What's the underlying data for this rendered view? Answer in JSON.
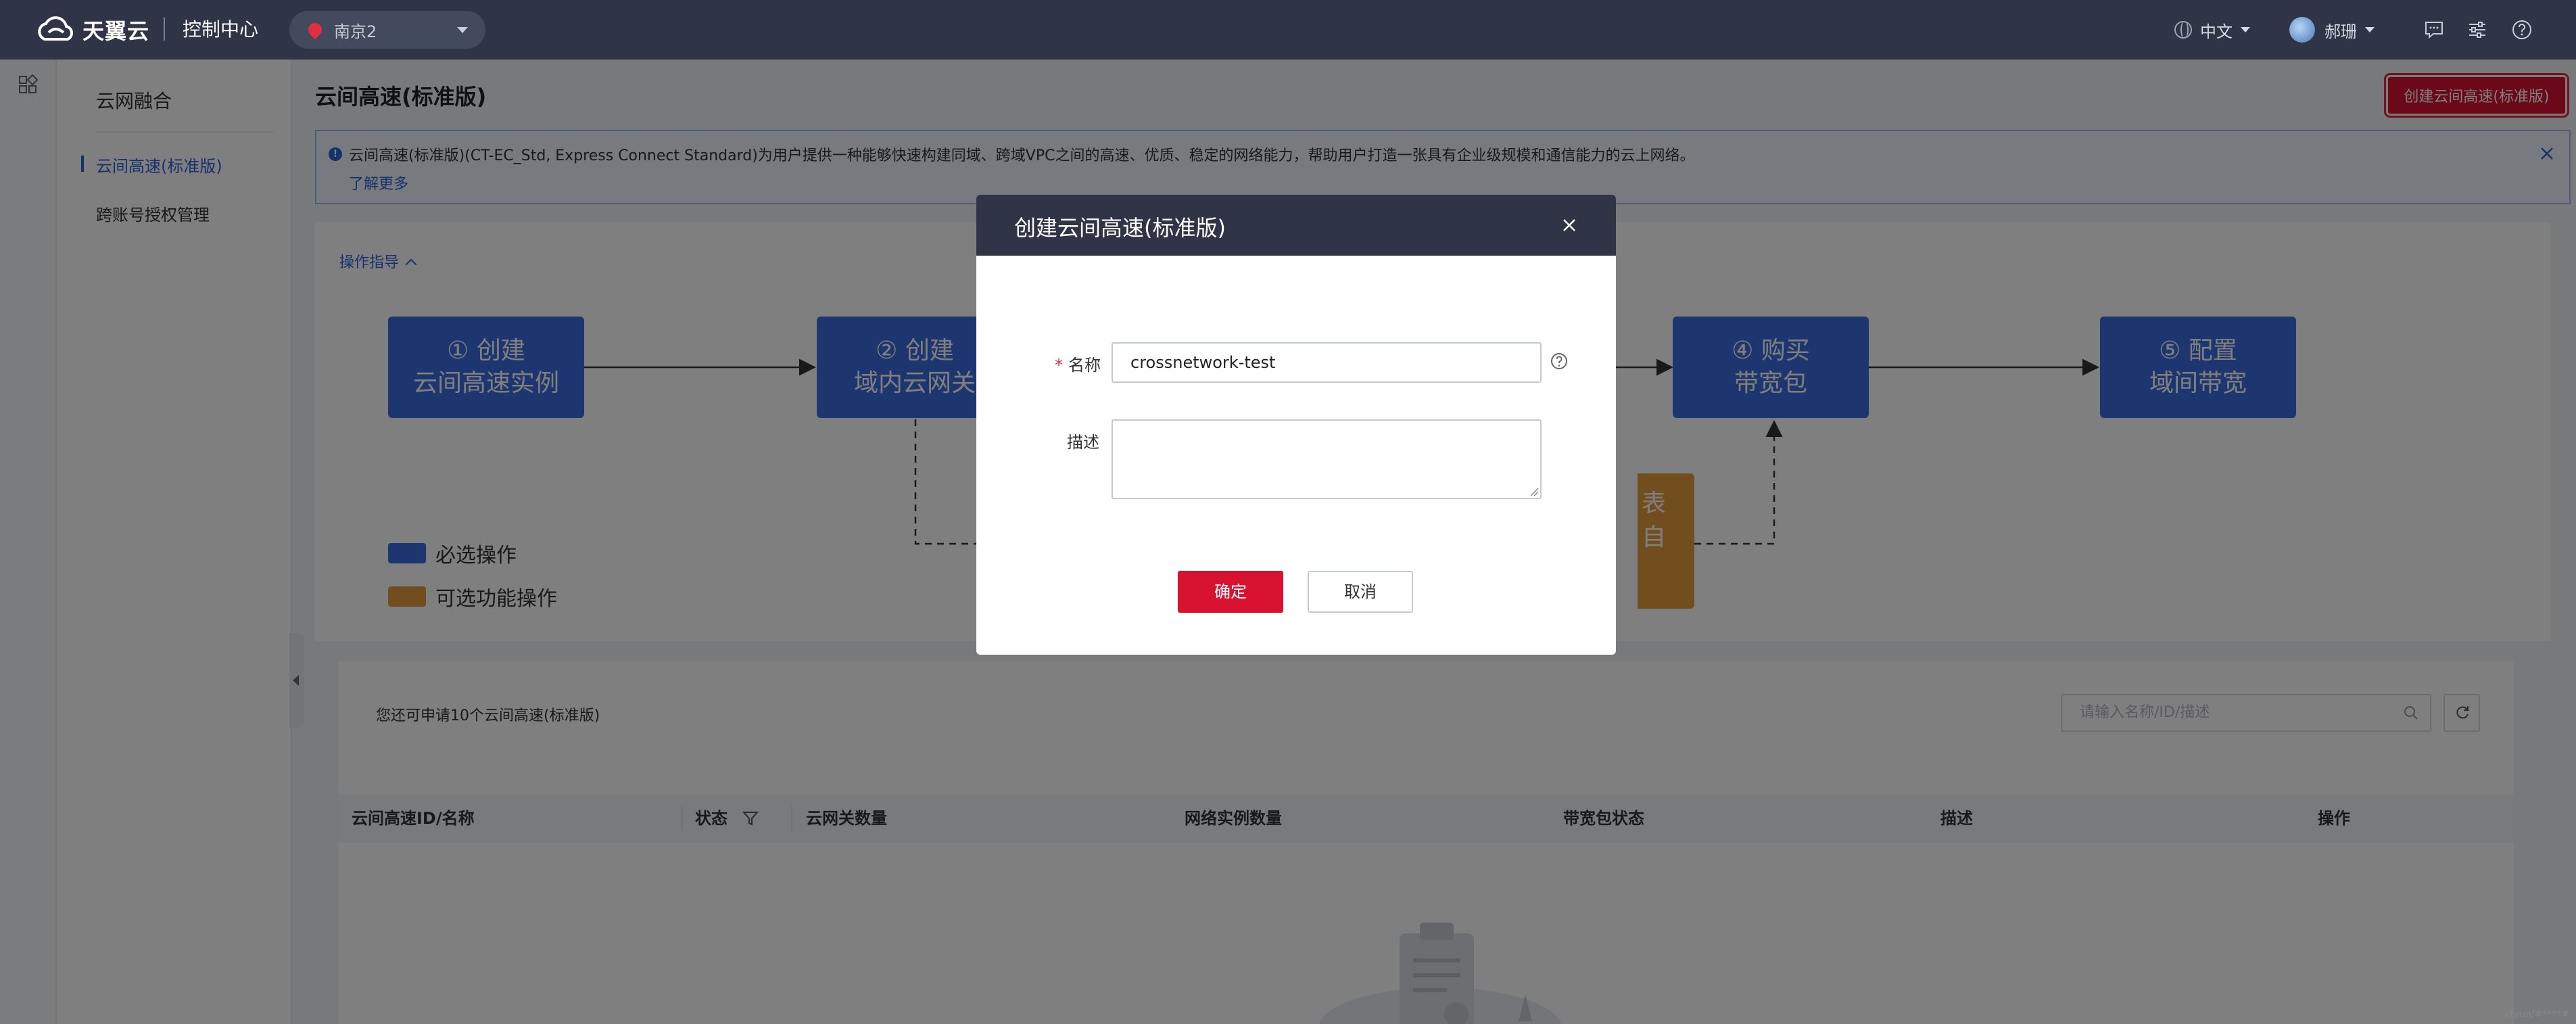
{
  "topbar": {
    "brand": "天翼云",
    "console": "控制中心",
    "region": "南京2",
    "language": "中文",
    "username": "郝珊"
  },
  "sidenav": {
    "title": "云网融合",
    "items": [
      {
        "label": "云间高速(标准版)",
        "active": true
      },
      {
        "label": "跨账号授权管理",
        "active": false
      }
    ]
  },
  "page": {
    "title": "云间高速(标准版)",
    "create_button": "创建云间高速(标准版)"
  },
  "notice": {
    "text": "云间高速(标准版)(CT-EC_Std, Express Connect Standard)为用户提供一种能够快速构建同域、跨域VPC之间的高速、优质、稳定的网络能力，帮助用户打造一张具有企业级规模和通信能力的云上网络。",
    "link": "了解更多"
  },
  "guide": {
    "toggle": "操作指导",
    "steps": [
      {
        "line1": "① 创建",
        "line2": "云间高速实例"
      },
      {
        "line1": "② 创建",
        "line2": "域内云网关"
      },
      {
        "line1": "④ 购买",
        "line2": "带宽包"
      },
      {
        "line1": "⑤ 配置",
        "line2": "域间带宽"
      }
    ],
    "optional_step_fragment": {
      "line1": "表",
      "line2": "自"
    },
    "legend": [
      {
        "label": "必选操作",
        "color": "#3d6ce0"
      },
      {
        "label": "可选功能操作",
        "color": "#e59a3a"
      }
    ]
  },
  "list": {
    "quota_text": "您还可申请10个云间高速(标准版)",
    "search_placeholder": "请输入名称/ID/描述",
    "columns": [
      "云间高速ID/名称",
      "状态",
      "云网关数量",
      "网络实例数量",
      "带宽包状态",
      "描述",
      "操作"
    ]
  },
  "modal": {
    "title": "创建云间高速(标准版)",
    "name_label": "名称",
    "name_value": "crossnetwork-test",
    "desc_label": "描述",
    "desc_value": "",
    "ok": "确定",
    "cancel": "取消"
  },
  "watermark": "ctyun/#****#",
  "colors": {
    "topbar": "#2f3547",
    "primary_red": "#d71331",
    "required_step_blue": "#3d6ce0",
    "optional_step_orange": "#e59a3a",
    "link_blue": "#2f63d6"
  }
}
